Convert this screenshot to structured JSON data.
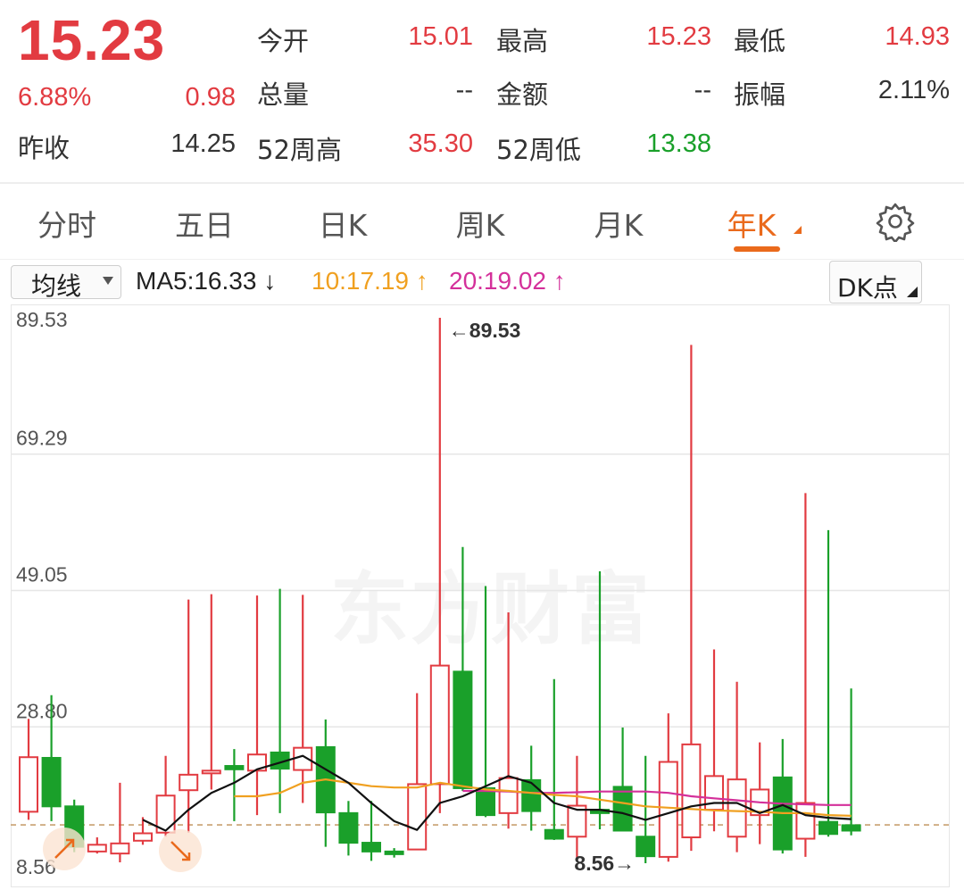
{
  "quote": {
    "price": "15.23",
    "change_pct": "6.88%",
    "change": "0.98",
    "prev_close_label": "昨收",
    "prev_close": "14.25",
    "open_label": "今开",
    "open": "15.01",
    "high_label": "最高",
    "high": "15.23",
    "low_label": "最低",
    "low": "14.93",
    "volume_label": "总量",
    "volume": "--",
    "amount_label": "金额",
    "amount": "--",
    "amplitude_label": "振幅",
    "amplitude": "2.11%",
    "wk52_high_label": "52周高",
    "wk52_high": "35.30",
    "wk52_low_label": "52周低",
    "wk52_low": "13.38"
  },
  "tabs": {
    "minute": "分时",
    "five_day": "五日",
    "day_k": "日K",
    "week_k": "周K",
    "month_k": "月K",
    "year_k": "年K",
    "active": "year_k"
  },
  "indicator_bar": {
    "ma_select": "均线",
    "ma5": "MA5:16.33 ↓",
    "ma10": "10:17.19 ↑",
    "ma20": "20:19.02 ↑",
    "dk_button": "DK点"
  },
  "colors": {
    "up": "#e23b41",
    "down": "#1aa02a",
    "accent": "#ea6a1c",
    "ma5": "#111111",
    "ma10": "#f0a020",
    "ma20": "#d4309a"
  },
  "watermark": "东方财富",
  "chart_data": {
    "type": "candlestick",
    "y_axis_labels": [
      "89.53",
      "69.29",
      "49.05",
      "28.80",
      "8.56"
    ],
    "ylim": [
      8.56,
      89.53
    ],
    "max_label": "89.53",
    "min_label": "8.56",
    "reference_line": 14.25,
    "candles": [
      {
        "o": 16.2,
        "c": 24.3,
        "h": 30.0,
        "l": 15.0
      },
      {
        "o": 24.2,
        "c": 17.0,
        "h": 33.5,
        "l": 14.8
      },
      {
        "o": 17.0,
        "c": 11.0,
        "h": 18.0,
        "l": 10.2
      },
      {
        "o": 10.3,
        "c": 11.3,
        "h": 12.4,
        "l": 10.0
      },
      {
        "o": 10.0,
        "c": 11.5,
        "h": 20.5,
        "l": 8.7
      },
      {
        "o": 11.9,
        "c": 13.0,
        "h": 15.4,
        "l": 11.3
      },
      {
        "o": 13.1,
        "c": 18.6,
        "h": 24.5,
        "l": 12.5
      },
      {
        "o": 19.4,
        "c": 21.7,
        "h": 47.7,
        "l": 13.1
      },
      {
        "o": 22.0,
        "c": 22.3,
        "h": 48.5,
        "l": 19.5
      },
      {
        "o": 23.0,
        "c": 22.5,
        "h": 25.5,
        "l": 14.8
      },
      {
        "o": 22.3,
        "c": 24.7,
        "h": 48.3,
        "l": 15.7
      },
      {
        "o": 25.0,
        "c": 22.6,
        "h": 49.3,
        "l": 16.0
      },
      {
        "o": 22.4,
        "c": 25.7,
        "h": 48.4,
        "l": 17.5
      },
      {
        "o": 25.8,
        "c": 16.1,
        "h": 29.9,
        "l": 11.0
      },
      {
        "o": 16.0,
        "c": 11.6,
        "h": 17.8,
        "l": 9.7
      },
      {
        "o": 11.6,
        "c": 10.3,
        "h": 17.8,
        "l": 8.9
      },
      {
        "o": 10.3,
        "c": 10.2,
        "h": 10.8,
        "l": 9.4
      },
      {
        "o": 10.6,
        "c": 20.3,
        "h": 33.8,
        "l": 10.5
      },
      {
        "o": 20.3,
        "c": 37.9,
        "h": 89.53,
        "l": 16.0
      },
      {
        "o": 37.0,
        "c": 19.7,
        "h": 55.5,
        "l": 19.3
      },
      {
        "o": 19.7,
        "c": 15.7,
        "h": 49.7,
        "l": 15.4
      },
      {
        "o": 16.0,
        "c": 21.2,
        "h": 45.8,
        "l": 13.7
      },
      {
        "o": 20.9,
        "c": 16.3,
        "h": 26.0,
        "l": 13.4
      },
      {
        "o": 13.5,
        "c": 12.2,
        "h": 35.9,
        "l": 12.0
      },
      {
        "o": 12.5,
        "c": 17.1,
        "h": 24.5,
        "l": 8.9
      },
      {
        "o": 16.5,
        "c": 16.0,
        "h": 51.9,
        "l": 13.6
      },
      {
        "o": 19.9,
        "c": 13.4,
        "h": 28.7,
        "l": 13.4
      },
      {
        "o": 12.5,
        "c": 9.6,
        "h": 24.5,
        "l": 8.56
      },
      {
        "o": 9.5,
        "c": 23.6,
        "h": 30.8,
        "l": 8.8
      },
      {
        "o": 12.4,
        "c": 26.2,
        "h": 85.5,
        "l": 10.4
      },
      {
        "o": 16.5,
        "c": 21.5,
        "h": 40.3,
        "l": 13.3
      },
      {
        "o": 12.5,
        "c": 21.0,
        "h": 35.5,
        "l": 10.2
      },
      {
        "o": 15.7,
        "c": 19.5,
        "h": 26.5,
        "l": 11.4
      },
      {
        "o": 21.3,
        "c": 10.6,
        "h": 27.0,
        "l": 10.0
      },
      {
        "o": 12.2,
        "c": 17.5,
        "h": 63.5,
        "l": 9.5
      },
      {
        "o": 14.7,
        "c": 12.9,
        "h": 58.0,
        "l": 12.5
      },
      {
        "o": 14.2,
        "c": 13.4,
        "h": 34.5,
        "l": 12.7
      }
    ],
    "ma5": [
      null,
      null,
      null,
      null,
      null,
      15.0,
      13.4,
      16.5,
      19.0,
      20.5,
      22.5,
      23.5,
      24.5,
      22.5,
      20.5,
      17.5,
      14.8,
      13.5,
      17.5,
      18.5,
      20.0,
      21.5,
      20.5,
      17.5,
      16.5,
      16.5,
      16.0,
      15.0,
      16.0,
      17.0,
      17.5,
      17.5,
      16.0,
      17.2,
      15.7,
      15.3,
      15.1
    ],
    "ma10": [
      null,
      null,
      null,
      null,
      null,
      null,
      null,
      null,
      null,
      18.5,
      18.5,
      19.0,
      20.5,
      21.0,
      20.5,
      20.0,
      19.8,
      19.8,
      20.5,
      20.0,
      19.5,
      19.3,
      19.0,
      18.7,
      18.5,
      18.0,
      17.5,
      17.0,
      16.8,
      16.6,
      16.4,
      16.3,
      16.2,
      16.0,
      16.0,
      15.7,
      15.6
    ],
    "ma20": [
      null,
      null,
      null,
      null,
      null,
      null,
      null,
      null,
      null,
      null,
      null,
      null,
      null,
      null,
      null,
      null,
      null,
      null,
      null,
      19.3,
      19.3,
      19.2,
      19.0,
      19.0,
      19.1,
      19.2,
      19.2,
      19.2,
      19.0,
      18.5,
      18.2,
      17.9,
      17.6,
      17.4,
      17.3,
      17.2,
      17.2
    ]
  }
}
